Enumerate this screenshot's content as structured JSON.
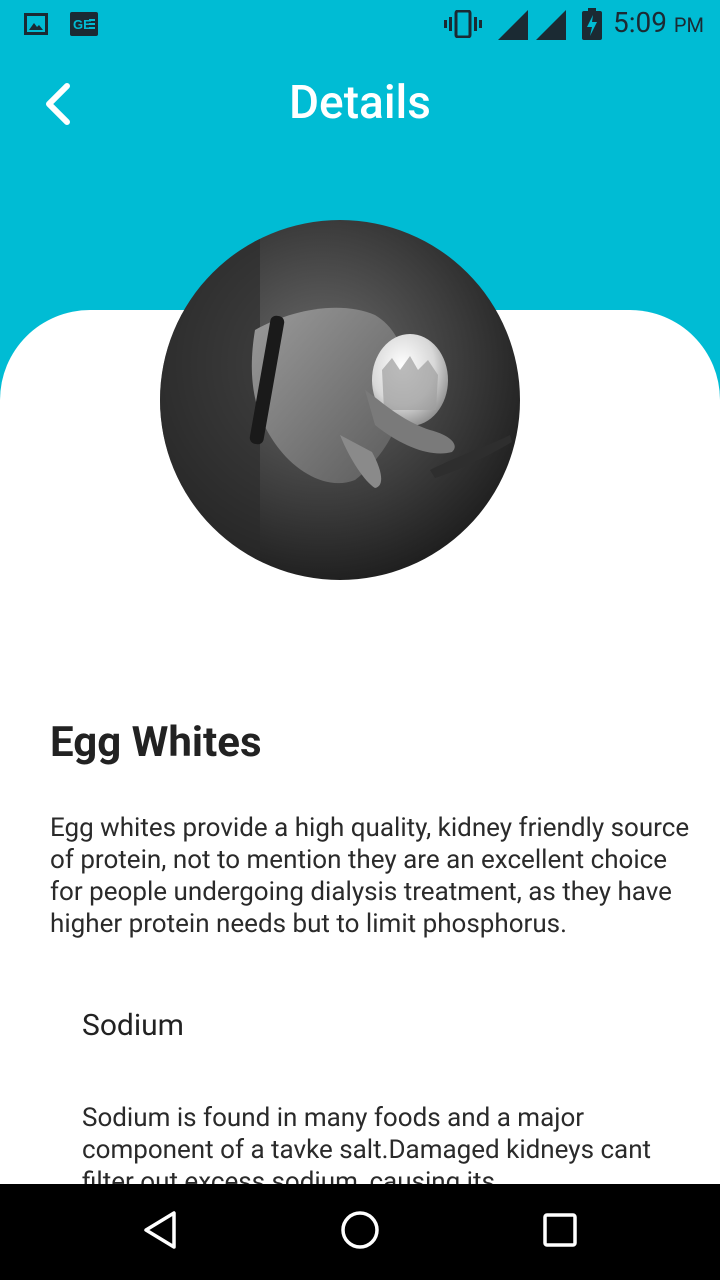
{
  "status_bar": {
    "time": "5:09",
    "ampm": "PM",
    "icons": [
      "image-notification-icon",
      "ge-app-icon",
      "vibrate-icon",
      "signal-icon",
      "signal-icon",
      "battery-charging-icon"
    ]
  },
  "app_bar": {
    "title": "Details",
    "back_icon": "chevron-left-icon"
  },
  "colors": {
    "header": "#00BCD4",
    "card": "#FFFFFF",
    "nav_bar": "#000000"
  },
  "item": {
    "title": "Egg Whites",
    "description": "Egg whites provide a high quality, kidney friendly source of protein, not to mention they are an excellent choice for people undergoing dialysis treatment, as they have higher protein needs but to limit phosphorus.",
    "nutrients": [
      {
        "name": "Sodium",
        "description": "Sodium is found in many foods and a major component of a tavke salt.Damaged kidneys cant filter out excess sodium, causing its"
      }
    ]
  },
  "nav_bar": {
    "icons": [
      "back-triangle-icon",
      "home-circle-icon",
      "recents-square-icon"
    ]
  }
}
